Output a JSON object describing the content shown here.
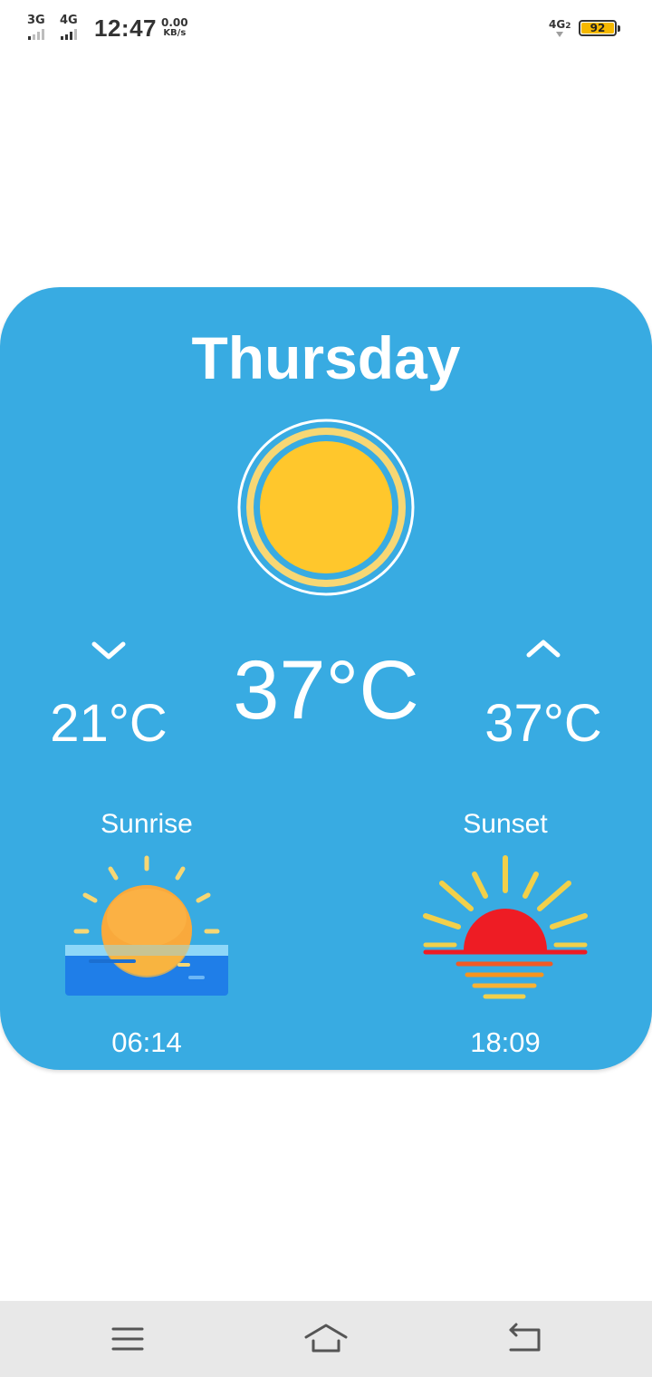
{
  "status_bar": {
    "sim1_label": "3G",
    "sim2_label": "4G",
    "time": "12:47",
    "net_speed_value": "0.00",
    "net_speed_unit": "KB/s",
    "right_network_label": "4G",
    "right_network_sub": "2",
    "battery_level": "92",
    "battery_color": "#f5b800"
  },
  "weather": {
    "day": "Thursday",
    "current_temp": "37°C",
    "low_temp": "21°C",
    "high_temp": "37°C",
    "condition_icon": "sun-icon",
    "sunrise_label": "Sunrise",
    "sunrise_time": "06:14",
    "sunset_label": "Sunset",
    "sunset_time": "18:09",
    "card_color": "#38abe2",
    "sun_color": "#ffc72c"
  },
  "nav_bar": {
    "icons": [
      "menu-icon",
      "home-icon",
      "back-icon"
    ]
  }
}
